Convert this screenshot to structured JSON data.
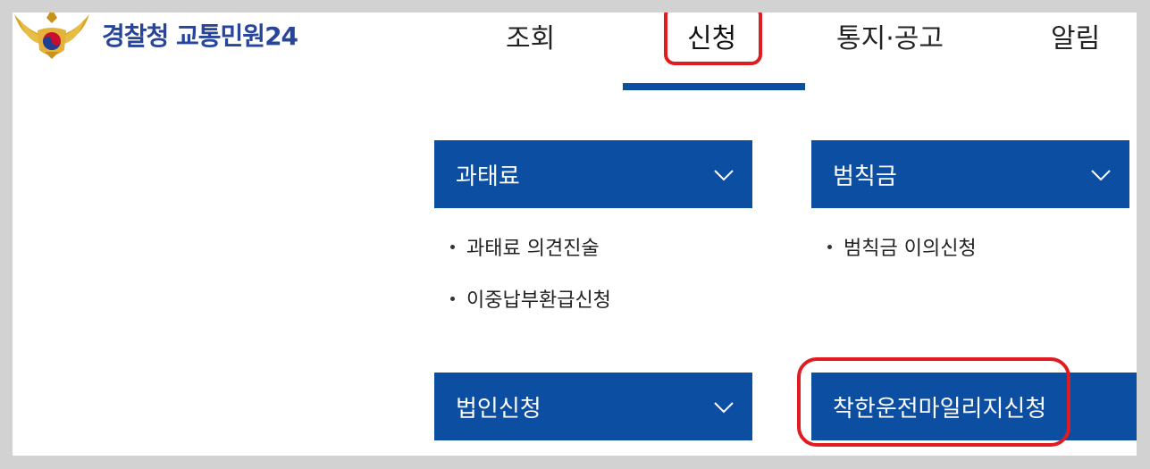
{
  "header": {
    "logo_text": "경찰청 교통민원24",
    "emblem_icon": "police-emblem-icon",
    "nav": [
      {
        "label": "조회"
      },
      {
        "label": "신청",
        "active": true
      },
      {
        "label": "통지·공고"
      },
      {
        "label": "알림"
      }
    ]
  },
  "colors": {
    "brand_blue": "#0b4ea2",
    "logo_blue": "#27459a",
    "highlight_red": "#e11b22"
  },
  "panels": [
    {
      "title": "과태료",
      "icon": "chevron-down-icon",
      "items": [
        "과태료 의견진술",
        "이중납부환급신청"
      ]
    },
    {
      "title": "범칙금",
      "icon": "chevron-down-icon",
      "items": [
        "범칙금 이의신청"
      ]
    },
    {
      "title": "법인신청",
      "icon": "chevron-down-icon",
      "items": []
    },
    {
      "title": "착한운전마일리지신청",
      "items": []
    }
  ]
}
